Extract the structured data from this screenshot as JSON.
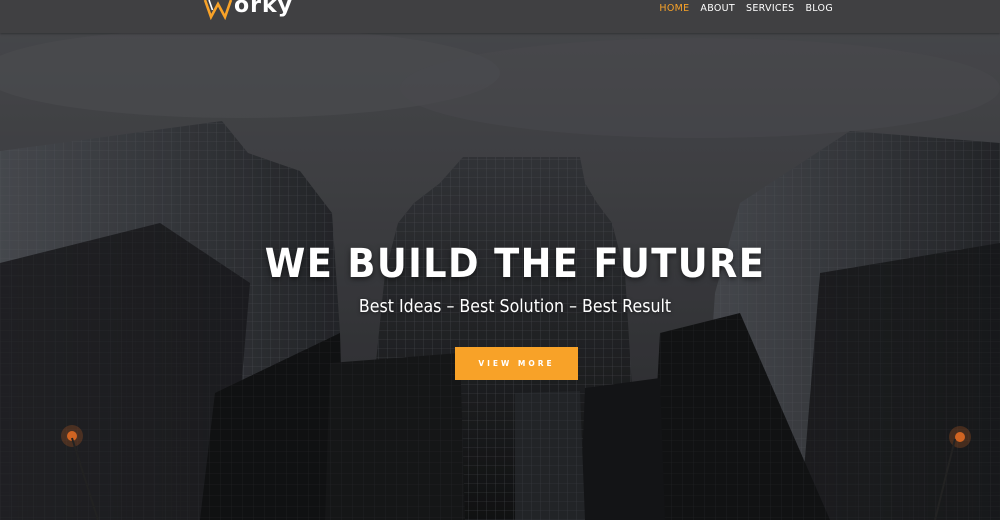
{
  "header": {
    "logo_text": "orky",
    "nav": [
      {
        "label": "HOME",
        "active": true
      },
      {
        "label": "ABOUT",
        "active": false
      },
      {
        "label": "SERVICES",
        "active": false
      },
      {
        "label": "BLOG",
        "active": false
      }
    ]
  },
  "hero": {
    "title": "WE BUILD THE FUTURE",
    "subtitle": "Best Ideas – Best Solution – Best Result",
    "cta_label": "VIEW MORE"
  },
  "colors": {
    "accent": "#f8a228",
    "header_bg": "#404042"
  }
}
